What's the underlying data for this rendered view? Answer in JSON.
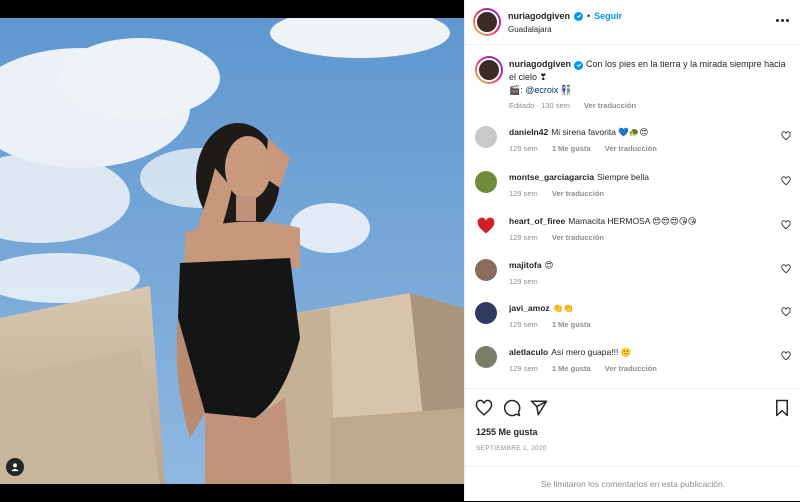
{
  "post": {
    "author": "nuriagodgiven",
    "location": "Guadalajara",
    "follow_label": "Seguir",
    "separator": "•",
    "caption_text": "Con los pies en la tierra y la mirada siempre hacia el cielo ❣",
    "caption_credit_prefix": "🎬: ",
    "caption_mention": "@ecroix",
    "caption_credit_suffix": " 👫🏻",
    "caption_meta_edited": "Editado · 130 sem",
    "see_translation": "Ver traducción",
    "likes": "1255 Me gusta",
    "date": "Septiembre 1, 2020",
    "comments_limited": "Se limitaron los comentarios en esta publicación."
  },
  "comments": [
    {
      "user": "danieln42",
      "text": "Mi sirena favorita 💙🐢😍",
      "time": "129 sem",
      "likes": "1 Me gusta",
      "translate": "Ver traducción",
      "avatar_color": "#c9c9c9"
    },
    {
      "user": "montse_garciagarcia",
      "text": "Siempre bella",
      "time": "129 sem",
      "likes": "",
      "translate": "Ver traducción",
      "avatar_color": "#6e8c3a"
    },
    {
      "user": "heart_of_firee",
      "text": "Mamacita HERMOSA 😍😍😍😘😘",
      "time": "129 sem",
      "likes": "",
      "translate": "Ver traducción",
      "avatar_color": "#d21f26"
    },
    {
      "user": "majitofa",
      "text": "😍",
      "time": "129 sem",
      "likes": "",
      "translate": "",
      "avatar_color": "#8a6b5c"
    },
    {
      "user": "javi_amoz",
      "text": "👏👏",
      "time": "129 sem",
      "likes": "1 Me gusta",
      "translate": "",
      "avatar_color": "#2e3a5e"
    },
    {
      "user": "aletlaculo",
      "text": "Así mero guapa!!! 🙂",
      "time": "129 sem",
      "likes": "1 Me gusta",
      "translate": "Ver traducción",
      "avatar_color": "#7b7f6a"
    }
  ],
  "colors": {
    "accent": "#0095f6",
    "muted": "#8e8e8e",
    "text": "#262626",
    "border": "#efefef"
  },
  "icons": [
    "user-tag-icon",
    "more-options-icon",
    "verified-icon",
    "heart-icon",
    "comment-icon",
    "share-icon",
    "bookmark-icon"
  ]
}
